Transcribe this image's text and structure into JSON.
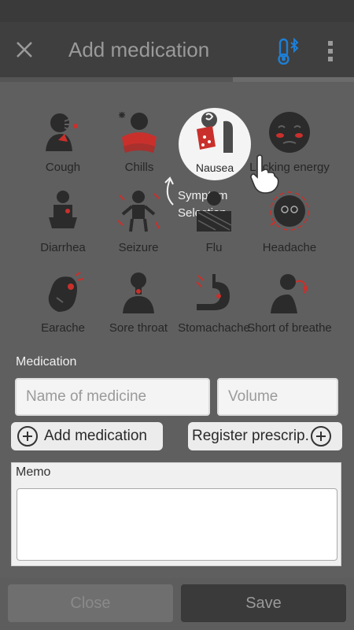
{
  "header": {
    "title": "Add medication",
    "close_icon": "close-icon",
    "thermometer_icon": "thermometer-bluetooth-icon",
    "more_icon": "more-vert-icon"
  },
  "symptoms": [
    {
      "label": "Cough",
      "icon": "cough-icon"
    },
    {
      "label": "Chills",
      "icon": "chills-icon"
    },
    {
      "label": "Nausea",
      "icon": "nausea-icon"
    },
    {
      "label": "Lacking energy",
      "icon": "lacking-energy-icon"
    },
    {
      "label": "Diarrhea",
      "icon": "diarrhea-icon"
    },
    {
      "label": "Seizure",
      "icon": "seizure-icon"
    },
    {
      "label": "Flu",
      "icon": "flu-icon"
    },
    {
      "label": "Headache",
      "icon": "headache-icon"
    },
    {
      "label": "Earache",
      "icon": "earache-icon"
    },
    {
      "label": "Sore throat",
      "icon": "sore-throat-icon"
    },
    {
      "label": "Stomachache",
      "icon": "stomachache-icon"
    },
    {
      "label": "Short of breathe",
      "icon": "short-of-breath-icon"
    }
  ],
  "hint": {
    "line1": "Symptom",
    "line2": "Selection"
  },
  "medication": {
    "section_label": "Medication",
    "name_placeholder": "Name of medicine",
    "volume_placeholder": "Volume",
    "add_label": "Add medication",
    "register_label": "Register prescrip."
  },
  "memo": {
    "label": "Memo",
    "value": ""
  },
  "footer": {
    "close_label": "Close",
    "save_label": "Save"
  },
  "colors": {
    "accent": "#1e7fd6",
    "symptom_red": "#c9302c",
    "icon_dark": "#2b2b2b"
  }
}
